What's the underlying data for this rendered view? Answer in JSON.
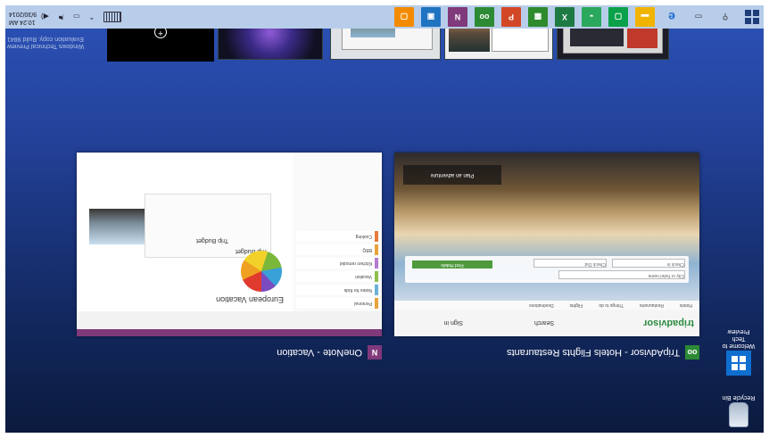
{
  "desktop": {
    "icons": [
      {
        "label": "Recycle Bin"
      },
      {
        "label": "Welcome to Tech Preview"
      }
    ],
    "watermark": {
      "line1": "Windows Technical Preview",
      "line2": "Evaluation copy. Build 9841"
    }
  },
  "task_view": {
    "windows": [
      {
        "title": "TripAdvisor - Hotels Flights Restaurants",
        "tab_text": "TripAdvisor: Hotels Flights Restaurants",
        "logo": "tripadvisor",
        "nav": [
          "Hotels",
          "Restaurants",
          "Things to do",
          "Flights",
          "Destinations"
        ],
        "search_label": "Search",
        "sign_in": "Sign in",
        "search_placeholder": "City or hotel name",
        "check_in": "Check in",
        "check_out": "Check Out",
        "find_button": "Find Hotels",
        "overlay_text": "Plan an adventure"
      },
      {
        "title": "OneNote - Vacation",
        "page_title": "European Vacation",
        "sections": [
          "Personal",
          "Notes for Kids",
          "Vacation",
          "Kitchen remodel",
          "BBQ",
          "Cooking"
        ],
        "card_title": "Trip Budget",
        "budget_title": "Trip Budget"
      }
    ],
    "desktops_strip": {
      "new_desktop_icon": "add-icon"
    }
  },
  "taskbar": {
    "start_icon": "windows-start-icon",
    "pinned": [
      {
        "name": "search-icon",
        "color": "#1e1e1e"
      },
      {
        "name": "task-view-icon",
        "color": "#1e1e1e"
      },
      {
        "name": "ie-icon",
        "color": "#1a6ad0"
      },
      {
        "name": "file-explorer-icon",
        "color": "#f0b400"
      },
      {
        "name": "store-icon",
        "glyph": "▢",
        "color": "#0aa14a"
      },
      {
        "name": "store-bag-icon",
        "glyph": "",
        "color": "#2aa85c"
      },
      {
        "name": "excel-icon",
        "glyph": "X",
        "color": "#1d7a43"
      },
      {
        "name": "project-icon",
        "glyph": "",
        "color": "#2d8b2d"
      },
      {
        "name": "powerpoint-icon",
        "glyph": "P",
        "color": "#d24726"
      },
      {
        "name": "tripadvisor-icon",
        "glyph": "oo",
        "color": "#2c8a35"
      },
      {
        "name": "onenote-icon",
        "glyph": "N",
        "color": "#80397b"
      },
      {
        "name": "photos-icon",
        "glyph": "",
        "color": "#1f73c1"
      },
      {
        "name": "reader-icon",
        "glyph": "",
        "color": "#f38b00"
      }
    ],
    "tray": {
      "keyboard_icon": "keyboard-icon",
      "chevron_icon": "chevron-up-icon",
      "network_icon": "network-icon",
      "flag_icon": "action-center-flag-icon",
      "volume_icon": "volume-icon"
    },
    "clock": {
      "time": "10:24 AM",
      "date": "9/30/2014"
    }
  }
}
